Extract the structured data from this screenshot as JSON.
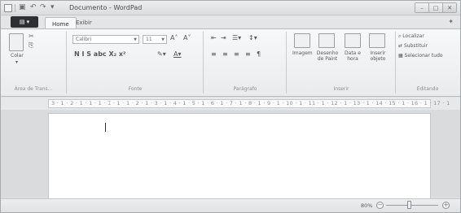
{
  "window": {
    "title": "Documento - WordPad",
    "quick_access": [
      "save-icon",
      "undo-icon",
      "redo-icon",
      "customize-icon"
    ]
  },
  "menu": {
    "app_button": "▤ ▾",
    "tabs": [
      {
        "label": "Home",
        "active": true
      },
      {
        "label": "Exibir",
        "active": false
      }
    ]
  },
  "ribbon": {
    "clipboard": {
      "paste_label": "Colar",
      "group_label": "Área de Trans..."
    },
    "font": {
      "name": "Calibri",
      "size": "11",
      "format_row": "N  I  S  abc  X₂  x²",
      "group_label": "Fonte"
    },
    "paragraph": {
      "group_label": "Parágrafo"
    },
    "insert": {
      "image_label": "Imagem",
      "paint_label": "Desenho de Paint",
      "datetime_label": "Data e hora",
      "object_label": "Inserir objeto",
      "group_label": "Inserir"
    },
    "editing": {
      "find_label": "Localizar",
      "replace_label": "Substituir",
      "selectall_label": "Selecionar tudo",
      "group_label": "Editando"
    }
  },
  "ruler": {
    "marks": "3 · 1 · 2 · 1 · 1 · 1 · ⌶ · 1 · 1 · 2 · 1 · 3 · 1 · 4 · 1 · 5 · 1 · 6 · 1 · 7 · 1 · 8 · 1 · 9 · 1 · 10 · 1 · 11 · 1 · 12 · 1 · 13 · 1 · 14 · 15 · 1 · 16 · 1 · 17 · 1"
  },
  "statusbar": {
    "zoom": "80%",
    "zoom_level": 0.45
  }
}
